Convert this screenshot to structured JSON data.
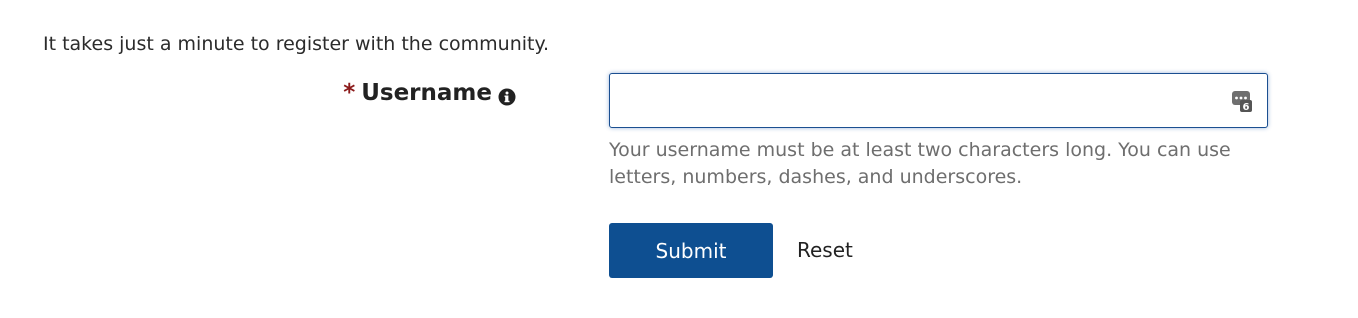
{
  "intro_text": "It takes just a minute to register with the community.",
  "username_field": {
    "required_marker": "*",
    "label": "Username",
    "info_icon": "info-circle-icon",
    "value": "",
    "placeholder": "",
    "password_manager_icon": "password-manager-icon",
    "password_manager_badge": "6",
    "help_text": "Your username must be at least two characters long. You can use letters, numbers, dashes, and underscores."
  },
  "actions": {
    "submit_label": "Submit",
    "reset_label": "Reset"
  },
  "colors": {
    "primary": "#0e4f91",
    "required": "#8b1a1a",
    "help_text": "#6e6e6e",
    "focus_border": "#1b4f91"
  }
}
